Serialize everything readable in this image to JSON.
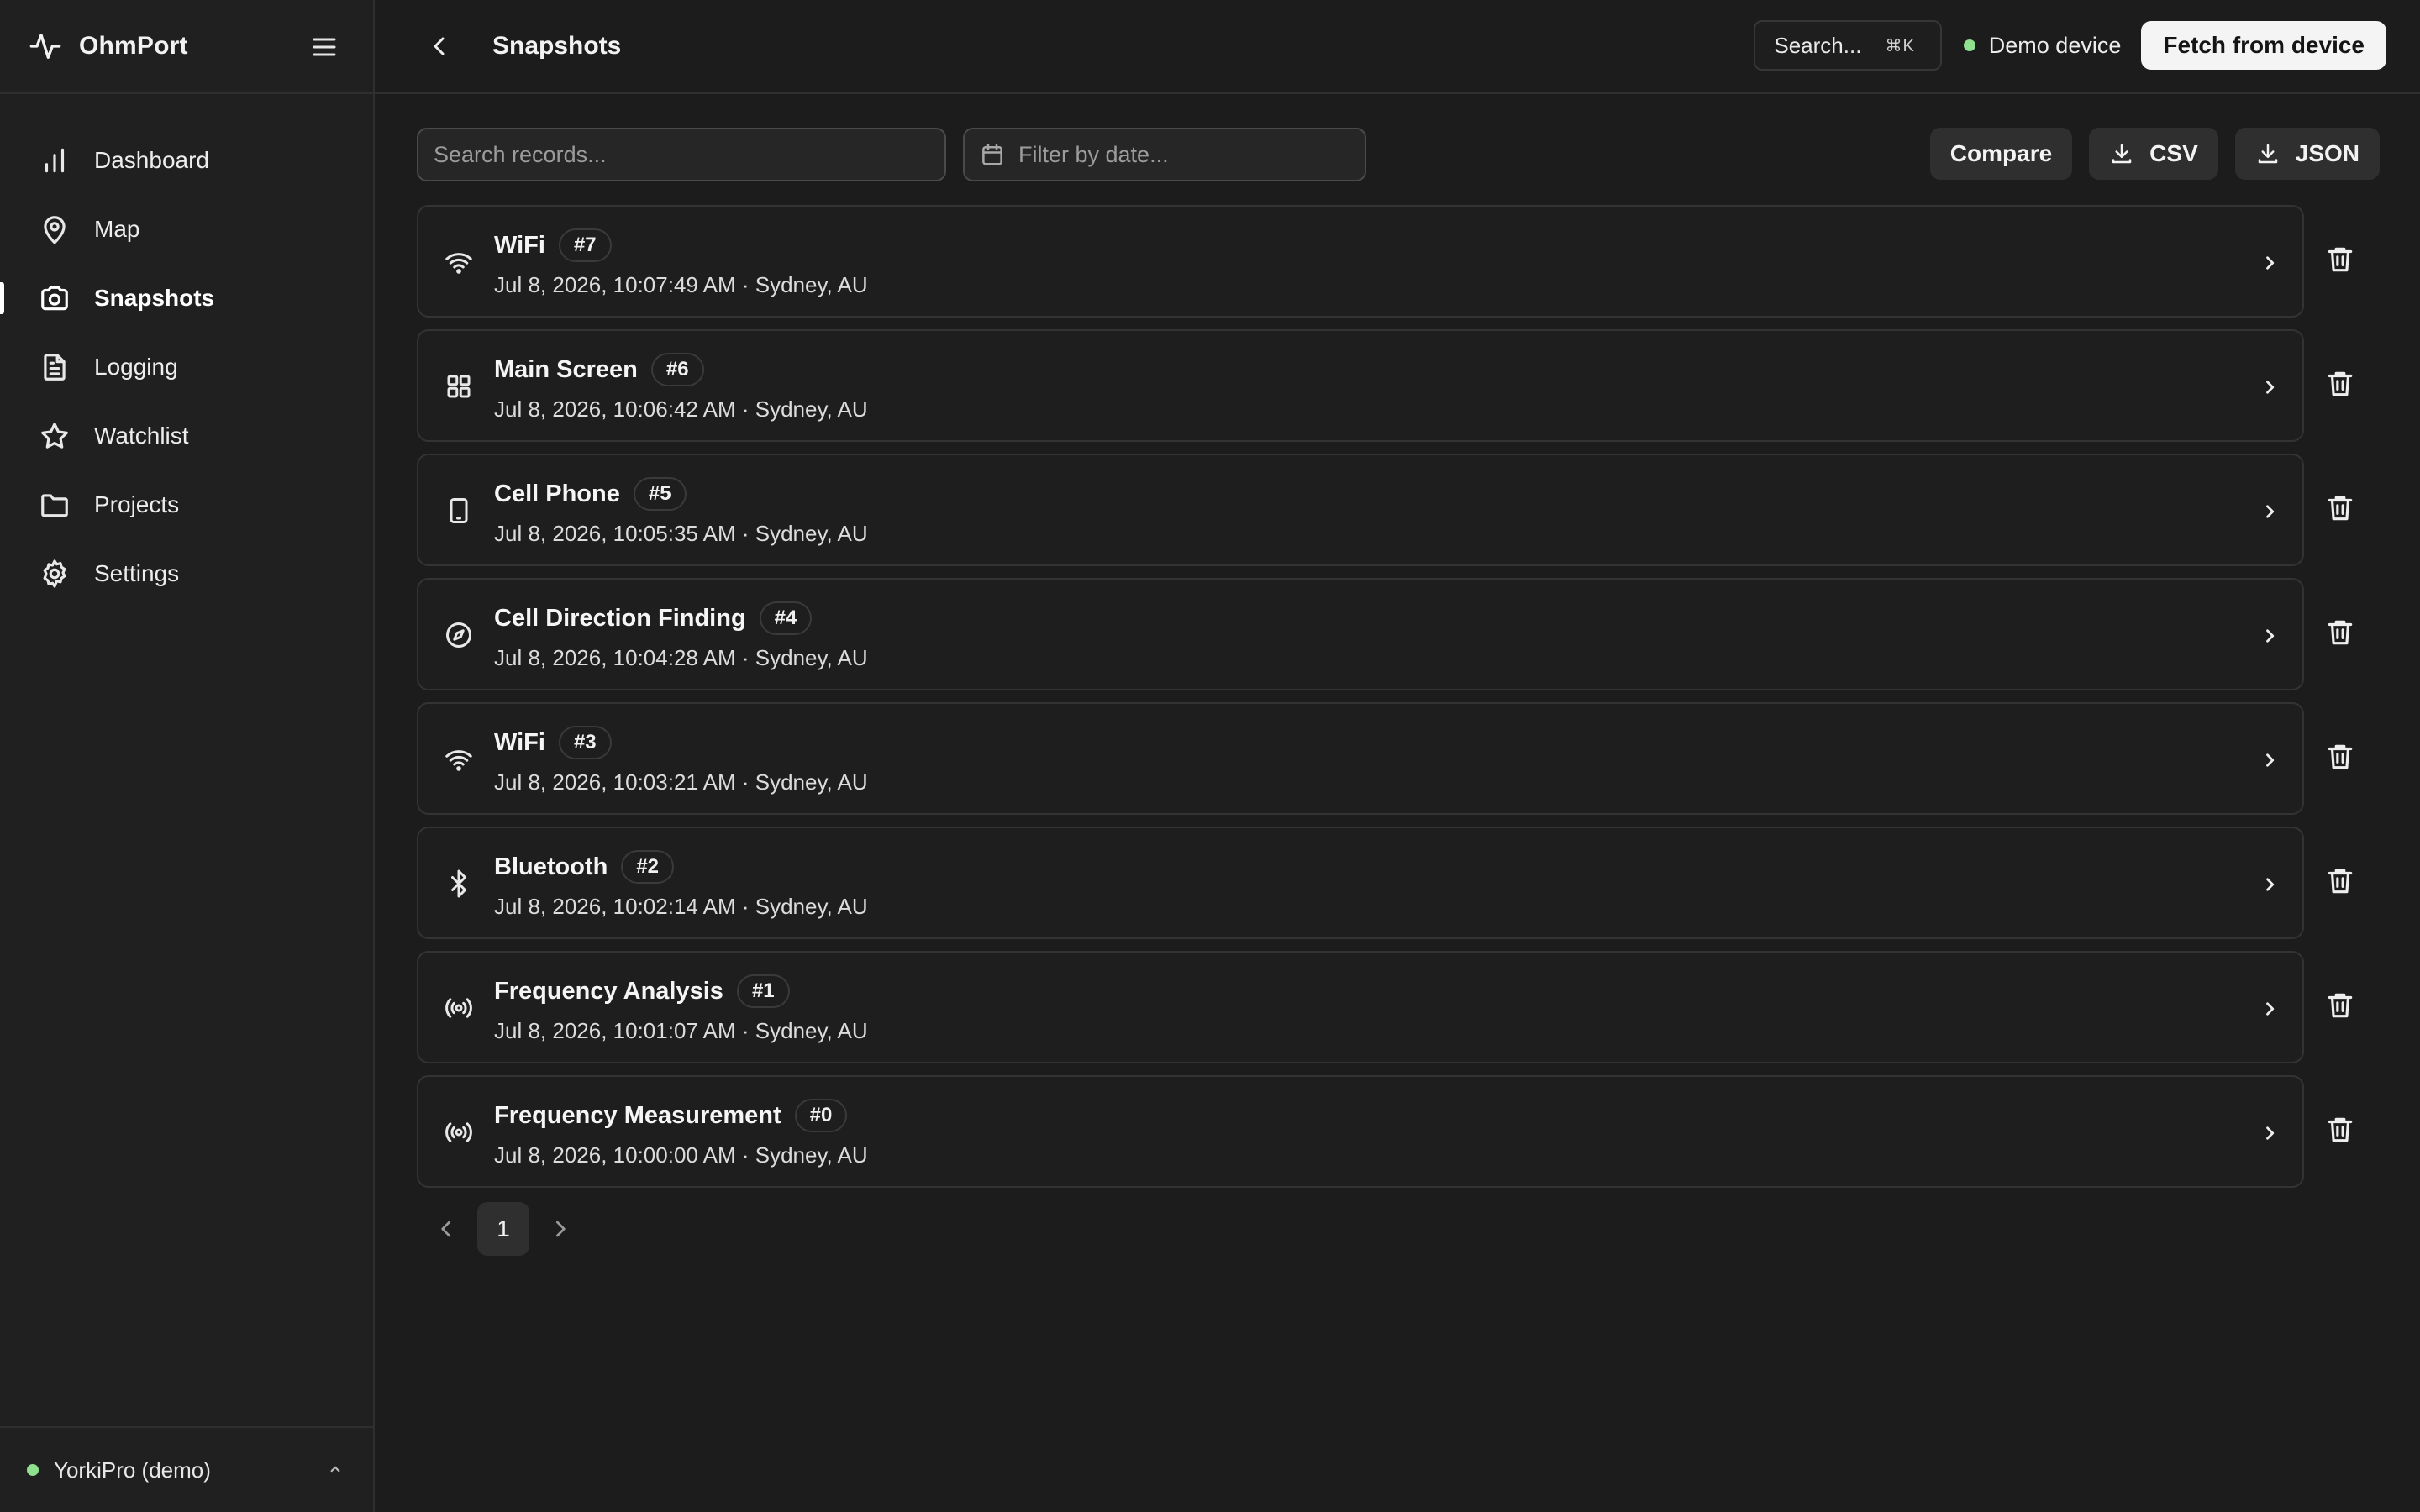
{
  "app": {
    "name": "OhmPort"
  },
  "sidebar": {
    "items": [
      {
        "label": "Dashboard",
        "icon": "bar-chart-icon"
      },
      {
        "label": "Map",
        "icon": "map-pin-icon"
      },
      {
        "label": "Snapshots",
        "icon": "camera-icon",
        "active": true
      },
      {
        "label": "Logging",
        "icon": "file-text-icon"
      },
      {
        "label": "Watchlist",
        "icon": "star-icon"
      },
      {
        "label": "Projects",
        "icon": "folder-icon"
      },
      {
        "label": "Settings",
        "icon": "gear-icon"
      }
    ],
    "device_name": "YorkiPro (demo)"
  },
  "header": {
    "title": "Snapshots",
    "search_label": "Search...",
    "search_shortcut": "⌘K",
    "device_status": "Demo device",
    "fetch_label": "Fetch from device"
  },
  "toolbar": {
    "search_placeholder": "Search records...",
    "date_placeholder": "Filter by date...",
    "compare_label": "Compare",
    "csv_label": "CSV",
    "json_label": "JSON"
  },
  "records": [
    {
      "name": "WiFi",
      "id": "#7",
      "meta": "Jul 8, 2026, 10:07:49 AM · Sydney, AU",
      "icon": "wifi-icon"
    },
    {
      "name": "Main Screen",
      "id": "#6",
      "meta": "Jul 8, 2026, 10:06:42 AM · Sydney, AU",
      "icon": "grid-icon"
    },
    {
      "name": "Cell Phone",
      "id": "#5",
      "meta": "Jul 8, 2026, 10:05:35 AM · Sydney, AU",
      "icon": "phone-icon"
    },
    {
      "name": "Cell Direction Finding",
      "id": "#4",
      "meta": "Jul 8, 2026, 10:04:28 AM · Sydney, AU",
      "icon": "compass-icon"
    },
    {
      "name": "WiFi",
      "id": "#3",
      "meta": "Jul 8, 2026, 10:03:21 AM · Sydney, AU",
      "icon": "wifi-icon"
    },
    {
      "name": "Bluetooth",
      "id": "#2",
      "meta": "Jul 8, 2026, 10:02:14 AM · Sydney, AU",
      "icon": "bluetooth-icon"
    },
    {
      "name": "Frequency Analysis",
      "id": "#1",
      "meta": "Jul 8, 2026, 10:01:07 AM · Sydney, AU",
      "icon": "radio-icon"
    },
    {
      "name": "Frequency Measurement",
      "id": "#0",
      "meta": "Jul 8, 2026, 10:00:00 AM · Sydney, AU",
      "icon": "radio-icon"
    }
  ],
  "pagination": {
    "current": "1"
  },
  "colors": {
    "background": "#1c1c1c",
    "sidebar": "#202020",
    "status_green": "#8fe08f",
    "primary_button": "#f4f4f4"
  }
}
